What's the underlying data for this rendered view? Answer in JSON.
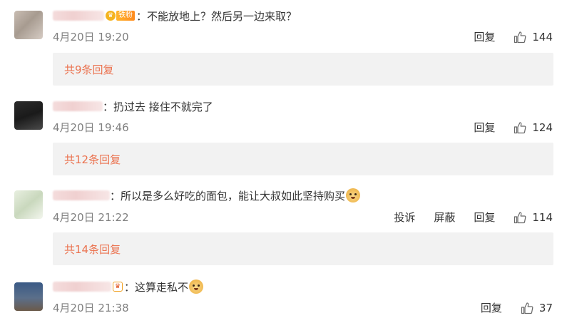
{
  "comments": [
    {
      "text": "：不能放地上？然后另一边来取？",
      "fan_badge": "铁粉",
      "date": "4月20日 19:20",
      "reply_label": "回复",
      "likes": "144",
      "replies_link": "共9条回复"
    },
    {
      "text": "：扔过去 接住不就完了",
      "date": "4月20日 19:46",
      "reply_label": "回复",
      "likes": "124",
      "replies_link": "共12条回复"
    },
    {
      "text": "：所以是多么好吃的面包，能让大叔如此坚持购买",
      "date": "4月20日 21:22",
      "report_label": "投诉",
      "block_label": "屏蔽",
      "reply_label": "回复",
      "likes": "114",
      "replies_link": "共14条回复"
    },
    {
      "text": "：这算走私不",
      "date": "4月20日 21:38",
      "reply_label": "回复",
      "likes": "37"
    }
  ],
  "colors": {
    "accent": "#eb7350",
    "muted": "#808080",
    "reply_bg": "#f2f2f2"
  },
  "icons": [
    "thumbs-up-icon",
    "doge-emoji",
    "crown-badge-icon"
  ]
}
